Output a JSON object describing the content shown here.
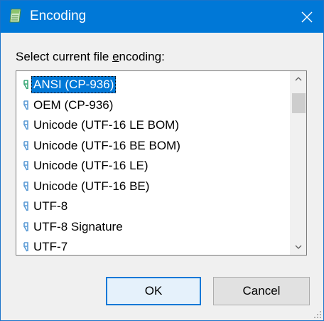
{
  "window": {
    "title": "Encoding"
  },
  "dialog": {
    "prompt_before": "Select current file ",
    "prompt_accel": "e",
    "prompt_after": "ncoding:"
  },
  "encodings": [
    {
      "label": "ANSI (CP-936)",
      "selected": true
    },
    {
      "label": "OEM (CP-936)",
      "selected": false
    },
    {
      "label": "Unicode (UTF-16 LE BOM)",
      "selected": false
    },
    {
      "label": "Unicode (UTF-16 BE BOM)",
      "selected": false
    },
    {
      "label": "Unicode (UTF-16 LE)",
      "selected": false
    },
    {
      "label": "Unicode (UTF-16 BE)",
      "selected": false
    },
    {
      "label": "UTF-8",
      "selected": false
    },
    {
      "label": "UTF-8 Signature",
      "selected": false
    },
    {
      "label": "UTF-7",
      "selected": false
    }
  ],
  "buttons": {
    "ok": "OK",
    "cancel": "Cancel"
  },
  "icons": {
    "app": "notepad-icon",
    "close": "close-icon",
    "font_glyph": "font-glyph-icon",
    "scroll_up": "chevron-up-icon",
    "scroll_down": "chevron-down-icon",
    "resize": "resize-grip-icon"
  },
  "colors": {
    "titlebar": "#0078d7",
    "selection": "#0078d7",
    "glyph": "#5b9bd5",
    "glyph_selected": "#3aa877"
  }
}
